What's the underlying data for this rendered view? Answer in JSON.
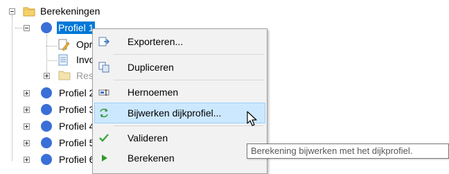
{
  "tree": {
    "root_label": "Berekeningen",
    "selected_label": "Profiel 1",
    "children": [
      {
        "label": "Opr"
      },
      {
        "label": "Invo"
      },
      {
        "label": "Resu"
      }
    ],
    "siblings": [
      {
        "label": "Profiel 2"
      },
      {
        "label": "Profiel 3"
      },
      {
        "label": "Profiel 4"
      },
      {
        "label": "Profiel 5"
      },
      {
        "label": "Profiel 6"
      }
    ]
  },
  "context_menu": {
    "items": [
      {
        "label": "Exporteren...",
        "icon": "export-icon"
      },
      {
        "label": "Dupliceren",
        "icon": "duplicate-icon"
      },
      {
        "label": "Hernoemen",
        "icon": "rename-icon"
      },
      {
        "label": "Bijwerken dijkprofiel...",
        "icon": "update-icon",
        "highlighted": true
      },
      {
        "label": "Valideren",
        "icon": "validate-check-icon"
      },
      {
        "label": "Berekenen",
        "icon": "run-play-icon"
      }
    ]
  },
  "tooltip": {
    "text": "Berekening bijwerken met het dijkprofiel."
  },
  "colors": {
    "selection": "#0078d7",
    "menu_hover": "#cce8ff",
    "node_icon": "#3a6fd8"
  }
}
